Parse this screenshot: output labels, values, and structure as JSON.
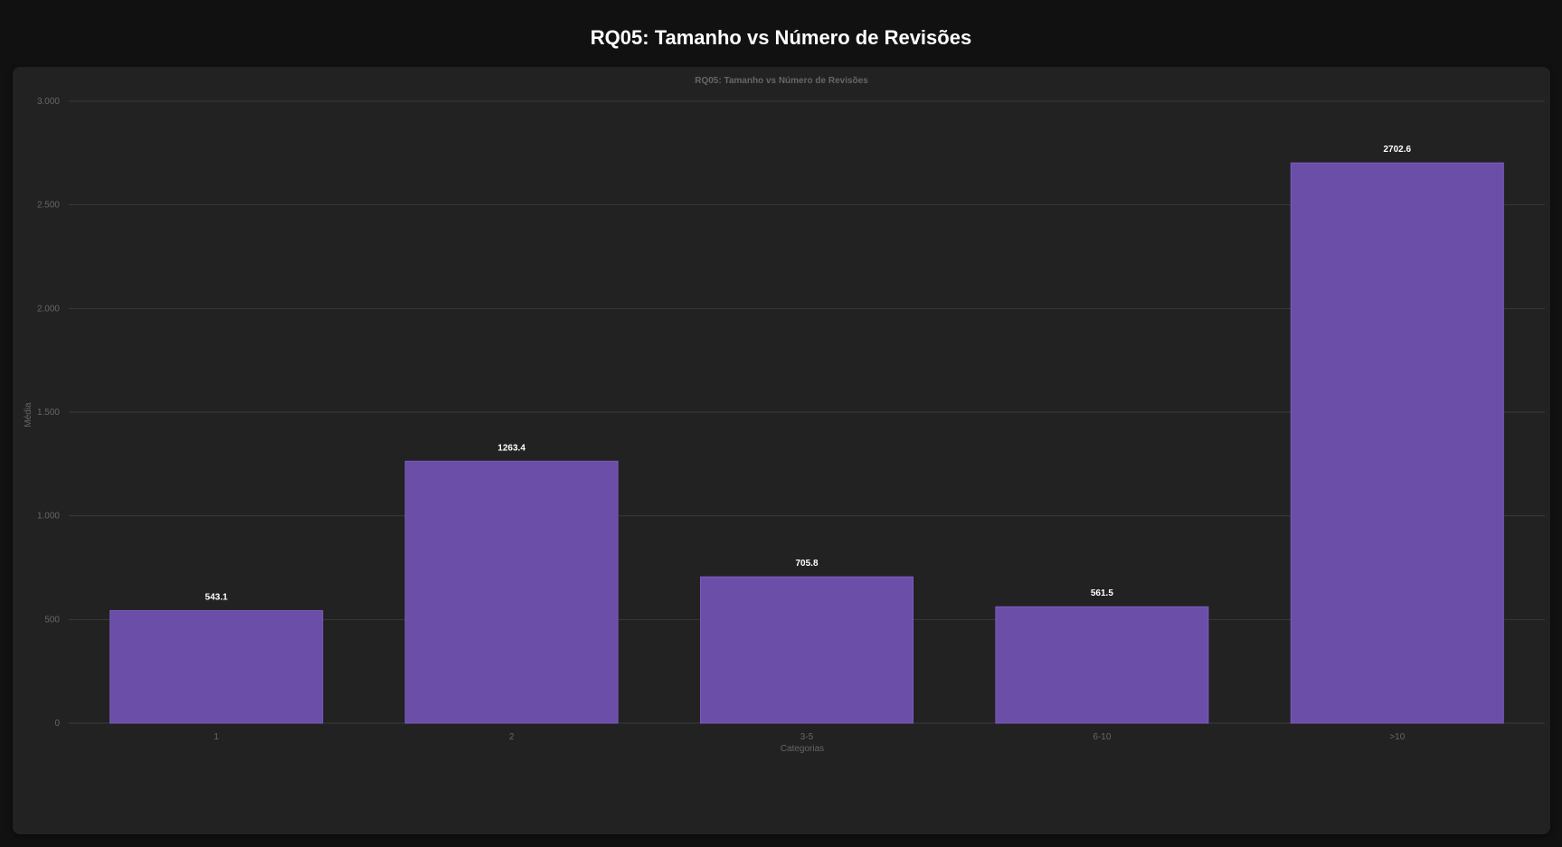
{
  "page": {
    "title": "RQ05: Tamanho vs Número de Revisões"
  },
  "colors": {
    "background": "#111111",
    "card": "#222222",
    "bar_fill": "#6b4ea8",
    "bar_border": "#7a5cc0",
    "grid": "#3a3a3a",
    "axis_text": "#666666",
    "data_label": "#ffffff"
  },
  "chart_data": {
    "type": "bar",
    "title": "RQ05: Tamanho vs Número de Revisões",
    "xlabel": "Categorias",
    "ylabel": "Média",
    "categories": [
      "1",
      "2",
      "3-5",
      "6-10",
      ">10"
    ],
    "values": [
      543.1,
      1263.4,
      705.8,
      561.5,
      2702.6
    ],
    "data_labels": [
      "543.1",
      "1263.4",
      "705.8",
      "561.5",
      "2702.6"
    ],
    "ylim": [
      0,
      3000
    ],
    "yticks": [
      0,
      500,
      1000,
      1500,
      2000,
      2500,
      3000
    ],
    "ytick_labels": [
      "0",
      "500",
      "1.000",
      "1.500",
      "2.000",
      "2.500",
      "3.000"
    ],
    "grid": true,
    "legend": "none"
  }
}
